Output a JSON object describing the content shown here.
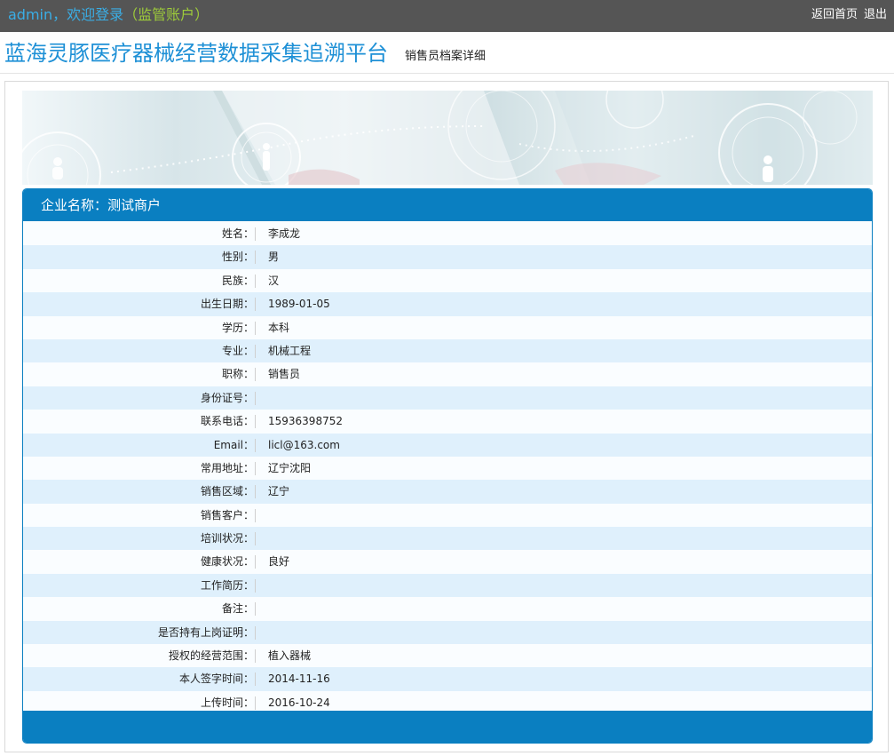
{
  "topbar": {
    "user": "admin",
    "separator": "，",
    "welcome": "欢迎登录",
    "account_type": "（监管账户）",
    "home_link": "返回首页",
    "logout_link": "退出"
  },
  "header": {
    "title": "蓝海灵豚医疗器械经营数据采集追溯平台",
    "subtitle": "销售员档案详细"
  },
  "panel": {
    "head_label": "企业名称：测试商户",
    "rows": [
      {
        "label": "姓名：",
        "value": "李成龙"
      },
      {
        "label": "性别：",
        "value": "男"
      },
      {
        "label": "民族：",
        "value": "汉"
      },
      {
        "label": "出生日期：",
        "value": "1989-01-05"
      },
      {
        "label": "学历：",
        "value": "本科"
      },
      {
        "label": "专业：",
        "value": "机械工程"
      },
      {
        "label": "职称：",
        "value": "销售员"
      },
      {
        "label": "身份证号：",
        "value": ""
      },
      {
        "label": "联系电话：",
        "value": "15936398752"
      },
      {
        "label": "Email：",
        "value": "licl@163.com"
      },
      {
        "label": "常用地址：",
        "value": "辽宁沈阳"
      },
      {
        "label": "销售区域：",
        "value": "辽宁"
      },
      {
        "label": "销售客户：",
        "value": ""
      },
      {
        "label": "培训状况：",
        "value": ""
      },
      {
        "label": "健康状况：",
        "value": "良好"
      },
      {
        "label": "工作简历：",
        "value": ""
      },
      {
        "label": "备注：",
        "value": ""
      },
      {
        "label": "是否持有上岗证明：",
        "value": ""
      },
      {
        "label": "授权的经营范围：",
        "value": "植入器械"
      },
      {
        "label": "本人签字时间：",
        "value": "2014-11-16"
      },
      {
        "label": "上传时间：",
        "value": "2016-10-24"
      }
    ]
  },
  "colors": {
    "topbar_bg": "#555555",
    "accent_blue": "#0a7fc1",
    "title_blue": "#1e90d6",
    "user_blue": "#3aaee6",
    "account_green": "#9ecc3a",
    "row_even": "#dff0fc"
  }
}
